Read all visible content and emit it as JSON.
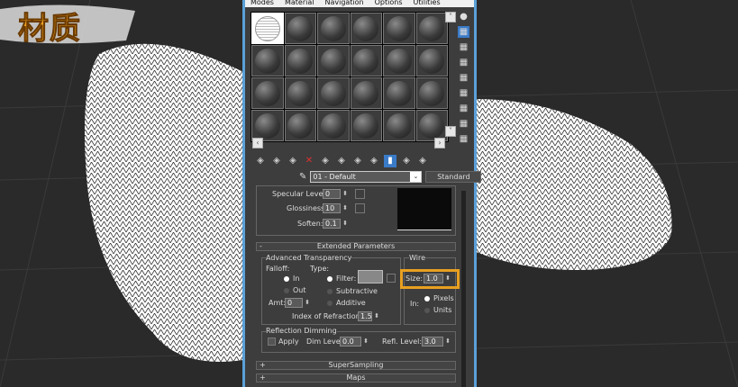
{
  "overlay_title": "材质",
  "menu": [
    "Modes",
    "Material",
    "Navigation",
    "Options",
    "Utilities"
  ],
  "slots": {
    "rows": 4,
    "cols": 6,
    "selected_index": 0
  },
  "right_toolbar": [
    "sample-type-icon",
    "backlight-icon",
    "background-icon",
    "uv-tiling-icon",
    "video-color-check-icon",
    "make-preview-icon",
    "options-icon",
    "select-by-material-icon",
    "material-map-navigator-icon"
  ],
  "bottom_toolbar": [
    "get-material-icon",
    "put-to-scene-icon",
    "assign-to-selection-icon",
    "delete-icon",
    "make-unique-icon",
    "put-to-library-icon",
    "material-id-icon",
    "show-shaded-icon",
    "show-end-result-icon",
    "go-to-parent-icon",
    "go-forward-icon"
  ],
  "material": {
    "name": "01 - Default",
    "type": "Standard"
  },
  "specular": {
    "specular_level_label": "Specular Level:",
    "specular_level": "0",
    "glossiness_label": "Glossiness:",
    "glossiness": "10",
    "soften_label": "Soften:",
    "soften": "0.1"
  },
  "extended": {
    "title": "Extended Parameters",
    "collapse": "-",
    "adv_title": "Advanced Transparency",
    "falloff": "Falloff:",
    "type": "Type:",
    "in": "In",
    "out": "Out",
    "filter": "Filter:",
    "subtractive": "Subtractive",
    "additive": "Additive",
    "amt_label": "Amt:",
    "amt": "0",
    "ior_label": "Index of Refraction:",
    "ior": "1.5",
    "wire_title": "Wire",
    "size_label": "Size:",
    "size": "1.0",
    "in_label": "In:",
    "pixels": "Pixels",
    "units": "Units",
    "refl_title": "Reflection Dimming",
    "apply": "Apply",
    "dim_label": "Dim Level:",
    "dim": "0.0",
    "refl_label": "Refl. Level:",
    "refl": "3.0"
  },
  "rollouts": [
    {
      "sign": "+",
      "label": "SuperSampling"
    },
    {
      "sign": "+",
      "label": "Maps"
    }
  ],
  "colors": {
    "highlight": "#e8a020",
    "window_border": "#5aa0d8",
    "selected_tool": "#3a7bc8"
  }
}
